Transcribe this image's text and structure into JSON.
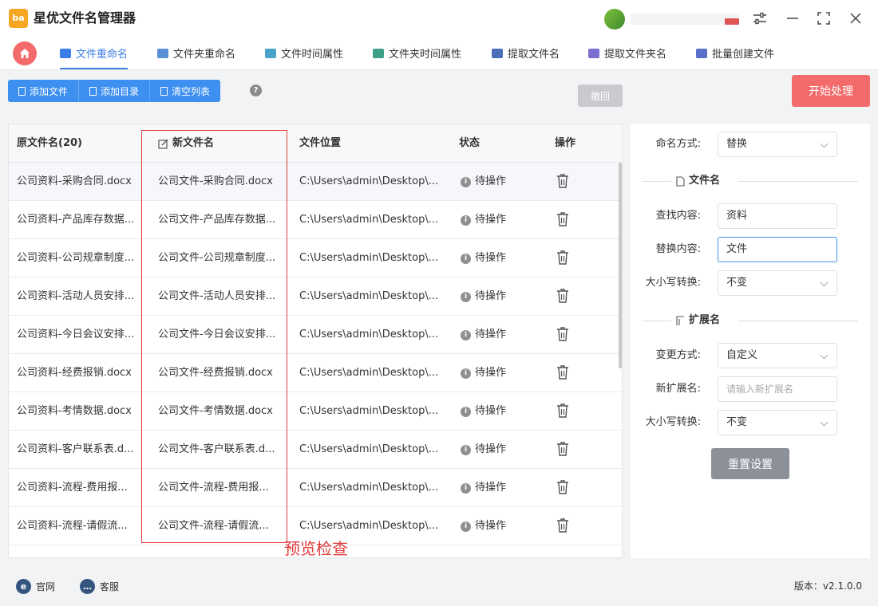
{
  "app": {
    "logo_text": "ba",
    "title": "星优文件名管理器"
  },
  "tabs": [
    {
      "label": "文件重命名",
      "active": true,
      "icon": "file-rename-icon",
      "color": "#3a7ee6"
    },
    {
      "label": "文件夹重命名",
      "active": false,
      "icon": "folder-rename-icon",
      "color": "#5a8fd6"
    },
    {
      "label": "文件时间属性",
      "active": false,
      "icon": "file-time-icon",
      "color": "#4aa3c9"
    },
    {
      "label": "文件夹时间属性",
      "active": false,
      "icon": "folder-time-icon",
      "color": "#3fa08a"
    },
    {
      "label": "提取文件名",
      "active": false,
      "icon": "extract-filename-icon",
      "color": "#4a6fb8"
    },
    {
      "label": "提取文件夹名",
      "active": false,
      "icon": "extract-foldername-icon",
      "color": "#7a6fd0"
    },
    {
      "label": "批量创建文件",
      "active": false,
      "icon": "batch-create-icon",
      "color": "#5a6fc8"
    }
  ],
  "toolbar": {
    "add_file": "添加文件",
    "add_dir": "添加目录",
    "clear_list": "清空列表",
    "help": "?",
    "undo": "撤回",
    "start": "开始处理"
  },
  "table": {
    "headers": {
      "original": "原文件名(20)",
      "new": "新文件名",
      "location": "文件位置",
      "status": "状态",
      "action": "操作"
    },
    "rows": [
      {
        "original": "公司资料-采购合同.docx",
        "new": "公司文件-采购合同.docx",
        "location": "C:\\Users\\admin\\Desktop\\...",
        "status": "待操作"
      },
      {
        "original": "公司资料-产品库存数据...",
        "new": "公司文件-产品库存数据...",
        "location": "C:\\Users\\admin\\Desktop\\...",
        "status": "待操作"
      },
      {
        "original": "公司资料-公司规章制度...",
        "new": "公司文件-公司规章制度...",
        "location": "C:\\Users\\admin\\Desktop\\...",
        "status": "待操作"
      },
      {
        "original": "公司资料-活动人员安排...",
        "new": "公司文件-活动人员安排...",
        "location": "C:\\Users\\admin\\Desktop\\...",
        "status": "待操作"
      },
      {
        "original": "公司资料-今日会议安排...",
        "new": "公司文件-今日会议安排...",
        "location": "C:\\Users\\admin\\Desktop\\...",
        "status": "待操作"
      },
      {
        "original": "公司资料-经费报销.docx",
        "new": "公司文件-经费报销.docx",
        "location": "C:\\Users\\admin\\Desktop\\...",
        "status": "待操作"
      },
      {
        "original": "公司资料-考情数据.docx",
        "new": "公司文件-考情数据.docx",
        "location": "C:\\Users\\admin\\Desktop\\...",
        "status": "待操作"
      },
      {
        "original": "公司资料-客户联系表.d...",
        "new": "公司文件-客户联系表.d...",
        "location": "C:\\Users\\admin\\Desktop\\...",
        "status": "待操作"
      },
      {
        "original": "公司资料-流程-费用报...",
        "new": "公司文件-流程-费用报...",
        "location": "C:\\Users\\admin\\Desktop\\...",
        "status": "待操作"
      },
      {
        "original": "公司资料-流程-请假流...",
        "new": "公司文件-流程-请假流...",
        "location": "C:\\Users\\admin\\Desktop\\...",
        "status": "待操作"
      }
    ]
  },
  "annotation": "预览检查",
  "settings": {
    "naming_label": "命名方式:",
    "naming_value": "替换",
    "filename_section": "文件名",
    "find_label": "查找内容:",
    "find_value": "资料",
    "replace_label": "替换内容:",
    "replace_value": "文件",
    "case_label": "大小写转换:",
    "case_value": "不变",
    "ext_section": "扩展名",
    "change_label": "变更方式:",
    "change_value": "自定义",
    "new_ext_label": "新扩展名:",
    "new_ext_placeholder": "请输入新扩展名",
    "ext_case_label": "大小写转换:",
    "ext_case_value": "不变",
    "reset": "重置设置"
  },
  "footer": {
    "website": "官网",
    "support": "客服",
    "version": "版本：v2.1.0.0"
  },
  "colors": {
    "accent": "#3a7ee6",
    "primary_button": "#3d8ff0",
    "start_button": "#f36b6b",
    "highlight": "#e03b3b"
  }
}
